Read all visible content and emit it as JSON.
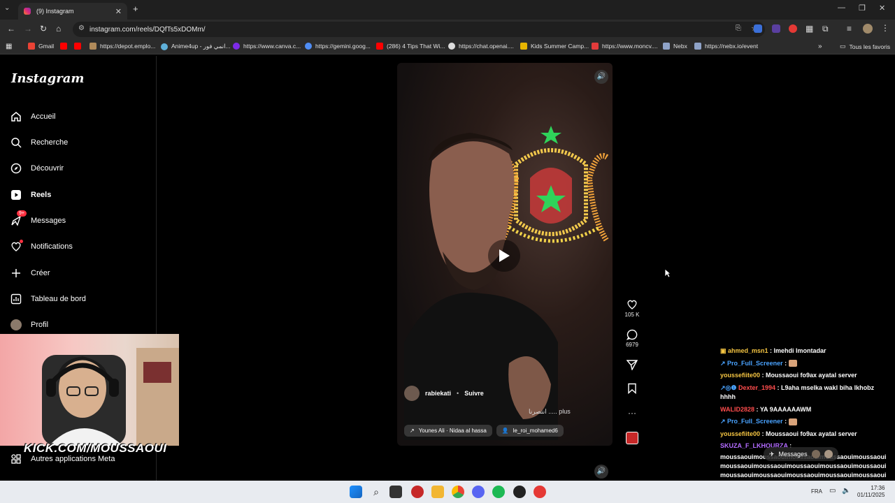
{
  "browser": {
    "tab_title": "(9) Instagram",
    "url": "instagram.com/reels/DQfTs5xDOMm/",
    "bookmarks": [
      {
        "label": "Gmail",
        "color": "#ea4335"
      },
      {
        "label": "",
        "color": "#ff0000"
      },
      {
        "label": "",
        "color": "#ff0000"
      },
      {
        "label": "https://depot.emplo...",
        "color": "#b08a5a"
      },
      {
        "label": "Anime4up - انمي فور...",
        "color": "#5fb0d9"
      },
      {
        "label": "https://www.canva.c...",
        "color": "#7d2ae8"
      },
      {
        "label": "https://gemini.goog...",
        "color": "#4f8df5"
      },
      {
        "label": "(286) 4 Tips That Wi...",
        "color": "#ff0000"
      },
      {
        "label": "https://chat.openai....",
        "color": "#dddddd"
      },
      {
        "label": "Kids Summer Camp...",
        "color": "#e6b400"
      },
      {
        "label": "https://www.moncv....",
        "color": "#e23b3b"
      },
      {
        "label": "Nebx",
        "color": "#8fa3c8"
      },
      {
        "label": "https://nebx.io/event",
        "color": "#8fa3c8"
      }
    ],
    "all_bookmarks": "Tous les favoris"
  },
  "sidebar": {
    "logo": "Instagram",
    "items": [
      {
        "label": "Accueil",
        "icon": "home-icon"
      },
      {
        "label": "Recherche",
        "icon": "search-icon"
      },
      {
        "label": "Découvrir",
        "icon": "compass-icon"
      },
      {
        "label": "Reels",
        "icon": "reels-icon"
      },
      {
        "label": "Messages",
        "icon": "messenger-icon",
        "badge": "9+"
      },
      {
        "label": "Notifications",
        "icon": "heart-icon"
      },
      {
        "label": "Créer",
        "icon": "plus-icon"
      },
      {
        "label": "Tableau de bord",
        "icon": "dashboard-icon"
      },
      {
        "label": "Profil",
        "icon": "avatar-icon"
      }
    ],
    "more_apps": "Autres applications Meta"
  },
  "reel": {
    "username": "rabiekati",
    "follow": "Suivre",
    "caption": "انتصرنا ..... plus",
    "audio": "Younes Ali · Nidaa al hassa",
    "tagged": "le_roi_mohamed6",
    "likes": "105 K",
    "comments": "6979"
  },
  "chat": [
    {
      "user": "ahmed_msn1",
      "color": "#f5c542",
      "msg": "lmehdi lmontadar"
    },
    {
      "user": "Pro_Full_Screener",
      "color": "#4aa3ff",
      "msg": "🙂"
    },
    {
      "user": "youssefiite00",
      "color": "#f5c542",
      "msg": "Moussaoui fo9ax ayatal server"
    },
    {
      "user": "Dexter_1994",
      "color": "#ff4d4d",
      "msg": "L9aha mselka wakl biha lkhobz hhhh"
    },
    {
      "user": "WALID2828",
      "color": "#ff4d4d",
      "msg": "YA 9AAAAAAWM"
    },
    {
      "user": "Pro_Full_Screener",
      "color": "#4aa3ff",
      "msg": "🙂"
    },
    {
      "user": "youssefiite00",
      "color": "#f5c542",
      "msg": "Moussaoui fo9ax ayatal server"
    },
    {
      "user": "SKUZA_F_LKHOURZA",
      "color": "#b36bff",
      "msg": ""
    }
  ],
  "spam": "moussaouimoussaouimoussaouimoussaouimoussaouimoussaouimoussaouimoussaouimoussaouimoussaouimoussaouimoussaouimoussaouimoussaouimoussaouimoussaouimoussaouimoussaouimoussaouimoussaouimoussaouimoussaouimoussaouimoussaoui",
  "messages_pill": "Messages",
  "webcam": {
    "overlay": "KICK.COM/MOUSSAOUI"
  },
  "taskbar": {
    "lang": "FRA",
    "time": "17:36",
    "date": "01/11/2025"
  }
}
